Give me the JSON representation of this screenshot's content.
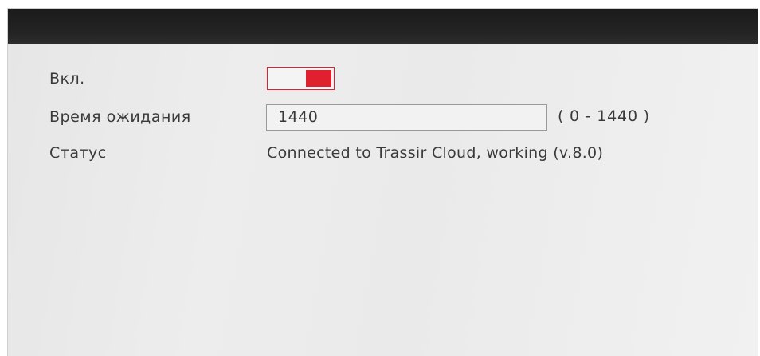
{
  "form": {
    "enable": {
      "label": "Вкл.",
      "state": "on",
      "accent_color": "#e0202e"
    },
    "timeout": {
      "label": "Время ожидания",
      "value": "1440",
      "range": "( 0 - 1440 )"
    },
    "status": {
      "label": "Статус",
      "value": "Connected to Trassir Cloud, working (v.8.0)"
    }
  }
}
